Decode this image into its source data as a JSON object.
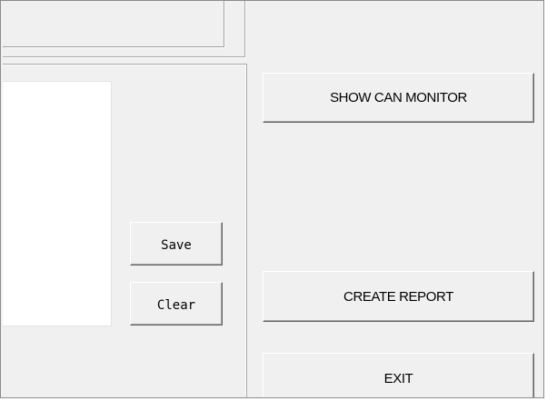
{
  "panel": {
    "save_label": "Save",
    "clear_label": "Clear"
  },
  "actions": {
    "show_can_monitor_label": "SHOW CAN MONITOR",
    "create_report_label": "CREATE REPORT",
    "exit_label": "EXIT"
  }
}
